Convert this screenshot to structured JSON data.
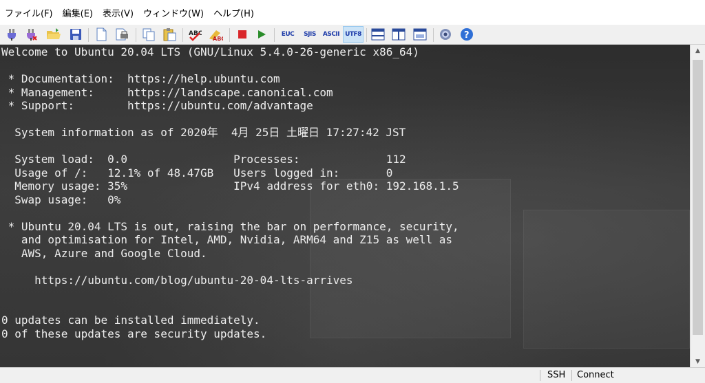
{
  "menu": {
    "items": [
      "ファイル(F)",
      "編集(E)",
      "表示(V)",
      "ウィンドウ(W)",
      "ヘルプ(H)"
    ]
  },
  "toolbar": {
    "encodings": [
      "EUC",
      "SJIS",
      "ASCII",
      "UTF8"
    ],
    "active_encoding": "UTF8",
    "icons": [
      "connect-icon",
      "disconnect-icon",
      "open-folder-icon",
      "save-icon",
      "new-document-icon",
      "print-icon",
      "copy-icon",
      "paste-icon",
      "spell-check-icon",
      "abc-check-icon",
      "stop-icon",
      "run-icon",
      "layout-horizontal-icon",
      "layout-vertical-icon",
      "layout-window-icon",
      "settings-gear-icon",
      "help-icon"
    ],
    "colors": {
      "stop": "#d9262a",
      "run": "#2a8c2a",
      "help": "#2f6fd6",
      "encoding_text": "#1c3aa8"
    }
  },
  "terminal": {
    "lines": [
      "Welcome to Ubuntu 20.04 LTS (GNU/Linux 5.4.0-26-generic x86_64)",
      "",
      " * Documentation:  https://help.ubuntu.com",
      " * Management:     https://landscape.canonical.com",
      " * Support:        https://ubuntu.com/advantage",
      "",
      "  System information as of 2020年  4月 25日 土曜日 17:27:42 JST",
      "",
      "  System load:  0.0                Processes:             112",
      "  Usage of /:   12.1% of 48.47GB   Users logged in:       0",
      "  Memory usage: 35%                IPv4 address for eth0: 192.168.1.5",
      "  Swap usage:   0%",
      "",
      " * Ubuntu 20.04 LTS is out, raising the bar on performance, security,",
      "   and optimisation for Intel, AMD, Nvidia, ARM64 and Z15 as well as",
      "   AWS, Azure and Google Cloud.",
      "",
      "     https://ubuntu.com/blog/ubuntu-20-04-lts-arrives",
      "",
      "",
      "0 updates can be installed immediately.",
      "0 of these updates are security updates."
    ]
  },
  "status": {
    "protocol": "SSH",
    "state": "Connect"
  }
}
